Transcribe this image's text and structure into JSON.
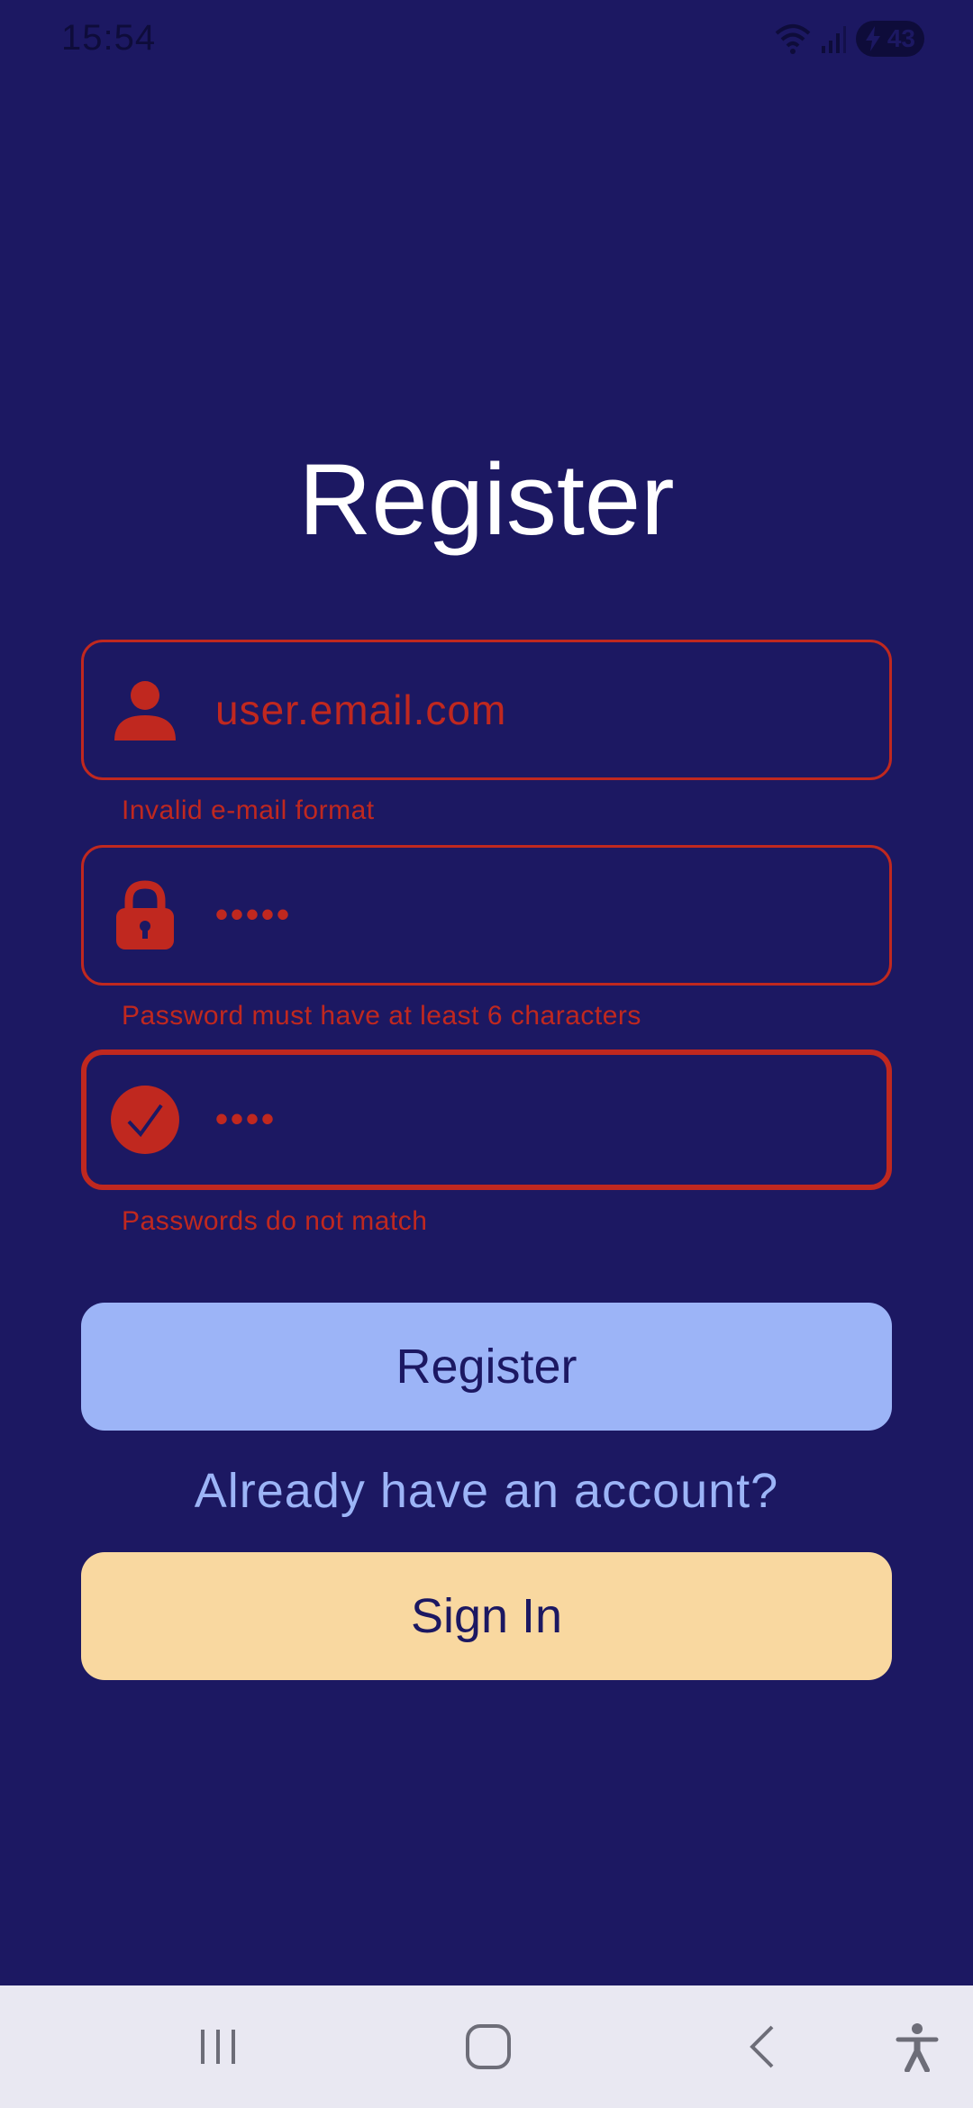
{
  "status_bar": {
    "time": "15:54",
    "battery": "43",
    "icons": [
      "wifi-icon",
      "signal-icon",
      "battery-icon"
    ]
  },
  "title": "Register",
  "fields": {
    "email": {
      "value": "user.email.com",
      "icon": "person-icon",
      "error": "Invalid e-mail format"
    },
    "password": {
      "value": "•••••",
      "icon": "lock-icon",
      "error": "Password must have at least 6 characters"
    },
    "confirm_password": {
      "value": "••••",
      "icon": "check-circle-icon",
      "error": "Passwords do not match"
    }
  },
  "buttons": {
    "register": "Register",
    "sign_in": "Sign In"
  },
  "link_text": "Already have an account?",
  "nav_bar": {
    "icons": [
      "recent-apps-icon",
      "home-icon",
      "back-icon",
      "accessibility-icon"
    ]
  },
  "colors": {
    "background": "#1c1862",
    "error": "#c0281f",
    "register_button": "#9cb4f7",
    "sign_in_button": "#f9d8a0",
    "title": "#ffffff"
  }
}
